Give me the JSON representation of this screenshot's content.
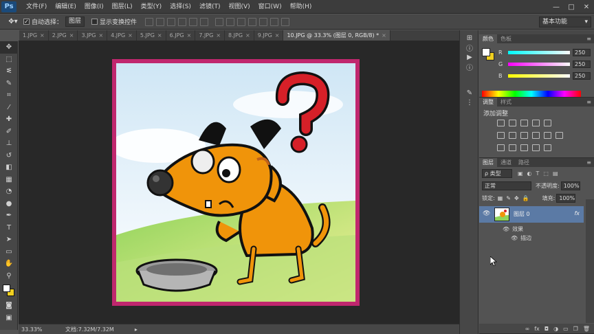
{
  "app": {
    "logo": "Ps",
    "menu": [
      "文件(F)",
      "编辑(E)",
      "图像(I)",
      "图层(L)",
      "类型(Y)",
      "选择(S)",
      "滤镜(T)",
      "视图(V)",
      "窗口(W)",
      "帮助(H)"
    ],
    "window_controls": [
      "—",
      "□",
      "✕"
    ]
  },
  "options": {
    "auto_select_label": "自动选择：",
    "auto_select_value": "图层",
    "show_transform_label": "显示变换控件",
    "workspace": "基本功能"
  },
  "tabs": [
    {
      "label": "1.JPG",
      "close": "×"
    },
    {
      "label": "2.JPG",
      "close": "×"
    },
    {
      "label": "3.JPG",
      "close": "×"
    },
    {
      "label": "4.JPG",
      "close": "×"
    },
    {
      "label": "5.JPG",
      "close": "×"
    },
    {
      "label": "6.JPG",
      "close": "×"
    },
    {
      "label": "7.JPG",
      "close": "×"
    },
    {
      "label": "8.JPG",
      "close": "×"
    },
    {
      "label": "9.JPG",
      "close": "×"
    },
    {
      "label": "10.JPG @ 33.3% (图层 0, RGB/8) *",
      "close": "×"
    }
  ],
  "status": {
    "zoom": "33.33%",
    "doc_info": "文档:7.32M/7.32M"
  },
  "color_panel": {
    "tabs": [
      "颜色",
      "色板"
    ],
    "fg_color": "#ffffff",
    "bg_color": "#f0cf20",
    "r_label": "R",
    "r_value": "250",
    "g_label": "G",
    "g_value": "250",
    "b_label": "B",
    "b_value": "250"
  },
  "adjust_panel": {
    "tabs": [
      "调整",
      "样式"
    ],
    "title": "添加调整"
  },
  "layers_panel": {
    "tabs": [
      "图层",
      "通道",
      "路径"
    ],
    "filter": "ρ 类型",
    "blend_mode": "正常",
    "opacity_label": "不透明度:",
    "opacity_value": "100%",
    "lock_label": "锁定:",
    "fill_label": "填充:",
    "fill_value": "100%",
    "layer_name": "图层 0",
    "fx": "fx",
    "effects_label": "效果",
    "stroke_label": "描边"
  },
  "colors": {
    "frame": "#c0276e",
    "dog": "#f0940a",
    "question": "#d62028",
    "selected_layer": "#5b7aa5"
  }
}
